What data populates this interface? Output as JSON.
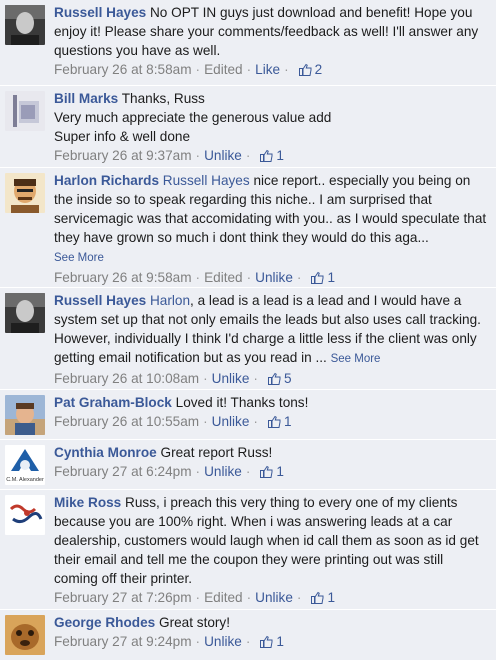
{
  "comments": [
    {
      "name": "Russell Hayes",
      "text": "No OPT IN guys just download and benefit! Hope you enjoy it! Please share your comments/feedback as well! I'll answer any questions you have as well.",
      "time": "February 26 at 8:58am",
      "edited": "Edited",
      "action": "Like",
      "likes": "2"
    },
    {
      "name": "Bill Marks",
      "text": "Thanks, Russ\nVery much appreciate the generous value add\nSuper info & well done",
      "time": "February 26 at 9:37am",
      "action": "Unlike",
      "likes": "1"
    },
    {
      "name": "Harlon Richards",
      "mention": "Russell Hayes",
      "text": " nice report.. especially you being on the inside so to speak regarding this niche.. I am surprised that servicemagic was that accomidating with you.. as I would speculate that they have grown so much i dont think they would do this aga...",
      "see_more": "See More",
      "time": "February 26 at 9:58am",
      "edited": "Edited",
      "action": "Unlike",
      "likes": "1"
    },
    {
      "name": "Russell Hayes",
      "mention": "Harlon",
      "text": ", a lead is a lead is a lead and I would have a system set up that not only emails the leads but also uses call tracking. However, individually I think I'd charge a little less if the client was only getting email notification but as you read in ... ",
      "see_more": "See More",
      "time": "February 26 at 10:08am",
      "action": "Unlike",
      "likes": "5"
    },
    {
      "name": "Pat Graham-Block",
      "text": "Loved it! Thanks tons!",
      "time": "February 26 at 10:55am",
      "action": "Unlike",
      "likes": "1"
    },
    {
      "name": "Cynthia Monroe",
      "text": "Great report Russ!",
      "time": "February 27 at 6:24pm",
      "action": "Unlike",
      "likes": "1",
      "avatar_caption": "C.M. Alexander"
    },
    {
      "name": "Mike Ross",
      "text": "Russ, i preach this very thing to every one of my clients because you are 100% right. When i was answering leads at a car dealership, customers would laugh when id call them as soon as id get their email and tell me the coupon they were printing out was still coming off their printer.",
      "time": "February 27 at 7:26pm",
      "edited": "Edited",
      "action": "Unlike",
      "likes": "1"
    },
    {
      "name": "George Rhodes",
      "text": "Great story!",
      "time": "February 27 at 9:24pm",
      "action": "Unlike",
      "likes": "1"
    }
  ],
  "separator": "·",
  "colors": {
    "background": "#edeff4",
    "link": "#3b5998",
    "meta": "#808080"
  },
  "icons": {
    "like": "thumbs-up-icon"
  }
}
